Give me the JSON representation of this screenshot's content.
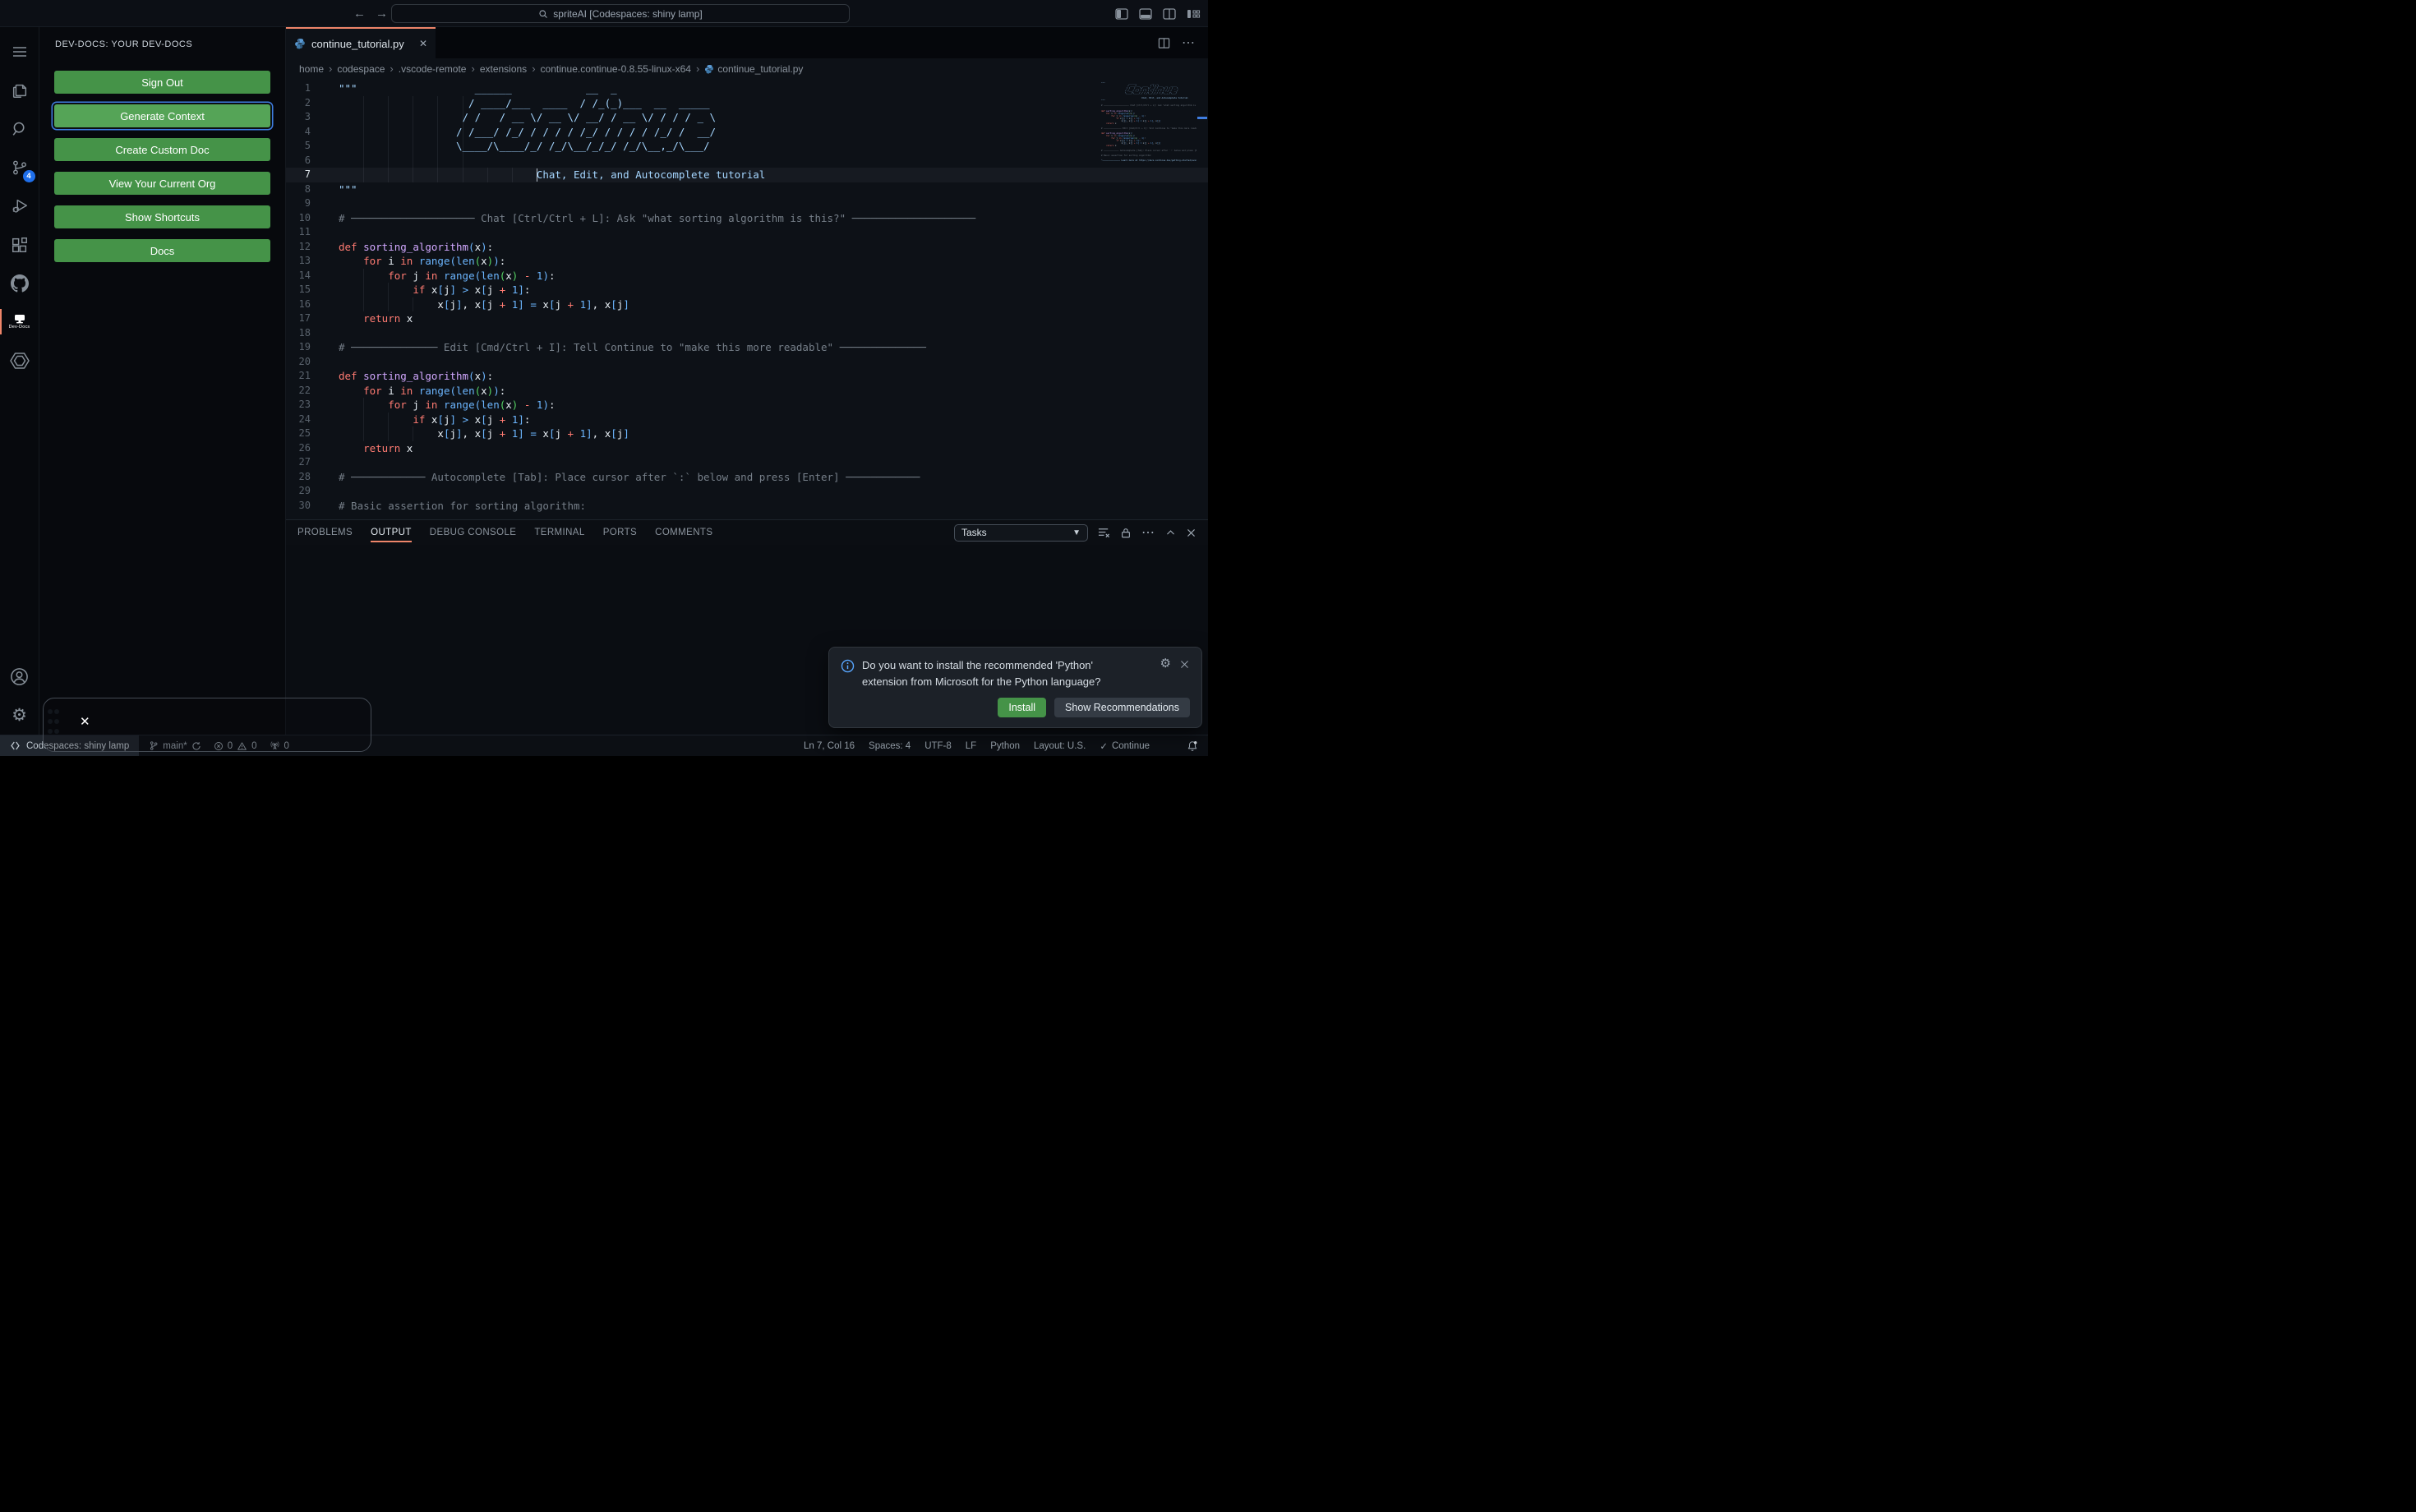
{
  "colors": {
    "accent_orange": "#ee8569",
    "button_green": "#459348",
    "focus_ring_blue": "#3f7de0",
    "badge_blue": "#1f6feb",
    "info_blue": "#58a6ff",
    "string_blue": "#a5d6ff",
    "keyword_red": "#ff7b72"
  },
  "titlebar": {
    "search": "spriteAI [Codespaces: shiny lamp]",
    "back": "←",
    "forward": "→"
  },
  "activity_bar": {
    "badge": "4",
    "devdocs": "Dev-Docs"
  },
  "sidebar": {
    "title": "DEV-DOCS: YOUR DEV-DOCS",
    "buttons": [
      {
        "label": "Sign Out"
      },
      {
        "label": "Generate Context",
        "focused": true
      },
      {
        "label": "Create Custom Doc"
      },
      {
        "label": "View Your Current Org"
      },
      {
        "label": "Show Shortcuts"
      },
      {
        "label": "Docs"
      }
    ]
  },
  "editor": {
    "tab": "continue_tutorial.py",
    "tab_close": "✕",
    "breadcrumbs": [
      "home",
      "codespace",
      ".vscode-remote",
      "extensions",
      "continue.continue-0.8.55-linux-x64",
      "continue_tutorial.py"
    ],
    "cursor": {
      "line": 7,
      "col": 16
    },
    "lines": [
      {
        "n": 1,
        "t": [
          [
            "s",
            "\"\"\"                   ______            __  _"
          ]
        ]
      },
      {
        "n": 2,
        "g": 5,
        "t": [
          [
            "s",
            "                     / ____/___  ____  / /_(_)___  __  _____"
          ]
        ]
      },
      {
        "n": 3,
        "g": 5,
        "t": [
          [
            "s",
            "                    / /   / __ \\/ __ \\/ __/ / __ \\/ / / / _ \\"
          ]
        ]
      },
      {
        "n": 4,
        "g": 5,
        "t": [
          [
            "s",
            "                   / /___/ /_/ / / / / /_/ / / / / /_/ /  __/"
          ]
        ]
      },
      {
        "n": 5,
        "g": 5,
        "t": [
          [
            "s",
            "                   \\____/\\____/_/ /_/\\__/_/_/ /_/\\__,_/\\___/"
          ]
        ]
      },
      {
        "n": 6,
        "g": 5,
        "t": []
      },
      {
        "n": 7,
        "g": 7,
        "t": [
          [
            "s",
            "                                Chat, Edit, and Autocomplete tutorial"
          ]
        ]
      },
      {
        "n": 8,
        "t": [
          [
            "s",
            "\"\"\""
          ]
        ]
      },
      {
        "n": 9,
        "t": []
      },
      {
        "n": 10,
        "t": [
          [
            "c",
            "# ──────────────────── Chat [Ctrl/Ctrl + L]: Ask \"what sorting algorithm is this?\" ────────────────────"
          ]
        ]
      },
      {
        "n": 11,
        "t": []
      },
      {
        "n": 12,
        "t": [
          [
            "k",
            "def"
          ],
          [
            "w",
            " "
          ],
          [
            "d",
            "sorting_algorithm"
          ],
          [
            "b",
            "("
          ],
          [
            "w",
            "x"
          ],
          [
            "b",
            ")"
          ],
          [
            "w",
            ":"
          ]
        ]
      },
      {
        "n": 13,
        "t": [
          [
            "w",
            "    "
          ],
          [
            "k",
            "for"
          ],
          [
            "w",
            " i "
          ],
          [
            "k",
            "in"
          ],
          [
            "w",
            " "
          ],
          [
            "b",
            "range"
          ],
          [
            "b",
            "("
          ],
          [
            "b",
            "len"
          ],
          [
            "e",
            "("
          ],
          [
            "w",
            "x"
          ],
          [
            "e",
            ")"
          ],
          [
            "b",
            ")"
          ],
          [
            "w",
            ":"
          ]
        ]
      },
      {
        "n": 14,
        "g": 1,
        "t": [
          [
            "w",
            "        "
          ],
          [
            "k",
            "for"
          ],
          [
            "w",
            " j "
          ],
          [
            "k",
            "in"
          ],
          [
            "w",
            " "
          ],
          [
            "b",
            "range"
          ],
          [
            "b",
            "("
          ],
          [
            "b",
            "len"
          ],
          [
            "e",
            "("
          ],
          [
            "w",
            "x"
          ],
          [
            "e",
            ")"
          ],
          [
            "w",
            " "
          ],
          [
            "k",
            "-"
          ],
          [
            "w",
            " "
          ],
          [
            "b",
            "1"
          ],
          [
            "b",
            ")"
          ],
          [
            "w",
            ":"
          ]
        ]
      },
      {
        "n": 15,
        "g": 2,
        "t": [
          [
            "w",
            "            "
          ],
          [
            "k",
            "if"
          ],
          [
            "w",
            " x"
          ],
          [
            "b",
            "["
          ],
          [
            "w",
            "j"
          ],
          [
            "b",
            "]"
          ],
          [
            "w",
            " "
          ],
          [
            "b",
            ">"
          ],
          [
            "w",
            " x"
          ],
          [
            "b",
            "["
          ],
          [
            "w",
            "j "
          ],
          [
            "k",
            "+"
          ],
          [
            "w",
            " "
          ],
          [
            "b",
            "1"
          ],
          [
            "b",
            "]"
          ],
          [
            "w",
            ":"
          ]
        ]
      },
      {
        "n": 16,
        "g": 3,
        "t": [
          [
            "w",
            "                x"
          ],
          [
            "b",
            "["
          ],
          [
            "w",
            "j"
          ],
          [
            "b",
            "]"
          ],
          [
            "w",
            ", x"
          ],
          [
            "b",
            "["
          ],
          [
            "w",
            "j "
          ],
          [
            "k",
            "+"
          ],
          [
            "w",
            " "
          ],
          [
            "b",
            "1"
          ],
          [
            "b",
            "]"
          ],
          [
            "w",
            " "
          ],
          [
            "b",
            "="
          ],
          [
            "w",
            " x"
          ],
          [
            "b",
            "["
          ],
          [
            "w",
            "j "
          ],
          [
            "k",
            "+"
          ],
          [
            "w",
            " "
          ],
          [
            "b",
            "1"
          ],
          [
            "b",
            "]"
          ],
          [
            "w",
            ", x"
          ],
          [
            "b",
            "["
          ],
          [
            "w",
            "j"
          ],
          [
            "b",
            "]"
          ]
        ]
      },
      {
        "n": 17,
        "t": [
          [
            "w",
            "    "
          ],
          [
            "k",
            "return"
          ],
          [
            "w",
            " x"
          ]
        ]
      },
      {
        "n": 18,
        "t": []
      },
      {
        "n": 19,
        "t": [
          [
            "c",
            "# ────────────── Edit [Cmd/Ctrl + I]: Tell Continue to \"make this more readable\" ──────────────"
          ]
        ]
      },
      {
        "n": 20,
        "t": []
      },
      {
        "n": 21,
        "t": [
          [
            "k",
            "def"
          ],
          [
            "w",
            " "
          ],
          [
            "d",
            "sorting_algorithm"
          ],
          [
            "b",
            "("
          ],
          [
            "w",
            "x"
          ],
          [
            "b",
            ")"
          ],
          [
            "w",
            ":"
          ]
        ]
      },
      {
        "n": 22,
        "t": [
          [
            "w",
            "    "
          ],
          [
            "k",
            "for"
          ],
          [
            "w",
            " i "
          ],
          [
            "k",
            "in"
          ],
          [
            "w",
            " "
          ],
          [
            "b",
            "range"
          ],
          [
            "b",
            "("
          ],
          [
            "b",
            "len"
          ],
          [
            "e",
            "("
          ],
          [
            "w",
            "x"
          ],
          [
            "e",
            ")"
          ],
          [
            "b",
            ")"
          ],
          [
            "w",
            ":"
          ]
        ]
      },
      {
        "n": 23,
        "g": 1,
        "t": [
          [
            "w",
            "        "
          ],
          [
            "k",
            "for"
          ],
          [
            "w",
            " j "
          ],
          [
            "k",
            "in"
          ],
          [
            "w",
            " "
          ],
          [
            "b",
            "range"
          ],
          [
            "b",
            "("
          ],
          [
            "b",
            "len"
          ],
          [
            "e",
            "("
          ],
          [
            "w",
            "x"
          ],
          [
            "e",
            ")"
          ],
          [
            "w",
            " "
          ],
          [
            "k",
            "-"
          ],
          [
            "w",
            " "
          ],
          [
            "b",
            "1"
          ],
          [
            "b",
            ")"
          ],
          [
            "w",
            ":"
          ]
        ]
      },
      {
        "n": 24,
        "g": 2,
        "t": [
          [
            "w",
            "            "
          ],
          [
            "k",
            "if"
          ],
          [
            "w",
            " x"
          ],
          [
            "b",
            "["
          ],
          [
            "w",
            "j"
          ],
          [
            "b",
            "]"
          ],
          [
            "w",
            " "
          ],
          [
            "b",
            ">"
          ],
          [
            "w",
            " x"
          ],
          [
            "b",
            "["
          ],
          [
            "w",
            "j "
          ],
          [
            "k",
            "+"
          ],
          [
            "w",
            " "
          ],
          [
            "b",
            "1"
          ],
          [
            "b",
            "]"
          ],
          [
            "w",
            ":"
          ]
        ]
      },
      {
        "n": 25,
        "g": 3,
        "t": [
          [
            "w",
            "                x"
          ],
          [
            "b",
            "["
          ],
          [
            "w",
            "j"
          ],
          [
            "b",
            "]"
          ],
          [
            "w",
            ", x"
          ],
          [
            "b",
            "["
          ],
          [
            "w",
            "j "
          ],
          [
            "k",
            "+"
          ],
          [
            "w",
            " "
          ],
          [
            "b",
            "1"
          ],
          [
            "b",
            "]"
          ],
          [
            "w",
            " "
          ],
          [
            "b",
            "="
          ],
          [
            "w",
            " x"
          ],
          [
            "b",
            "["
          ],
          [
            "w",
            "j "
          ],
          [
            "k",
            "+"
          ],
          [
            "w",
            " "
          ],
          [
            "b",
            "1"
          ],
          [
            "b",
            "]"
          ],
          [
            "w",
            ", x"
          ],
          [
            "b",
            "["
          ],
          [
            "w",
            "j"
          ],
          [
            "b",
            "]"
          ]
        ]
      },
      {
        "n": 26,
        "t": [
          [
            "w",
            "    "
          ],
          [
            "k",
            "return"
          ],
          [
            "w",
            " x"
          ]
        ]
      },
      {
        "n": 27,
        "t": []
      },
      {
        "n": 28,
        "t": [
          [
            "c",
            "# ──────────── Autocomplete [Tab]: Place cursor after `:` below and press [Enter] ────────────"
          ]
        ]
      },
      {
        "n": 29,
        "t": []
      },
      {
        "n": 30,
        "t": [
          [
            "c",
            "# Basic assertion for sorting algorithm:"
          ]
        ]
      }
    ],
    "minimap_tail": [
      {
        "t": []
      },
      {
        "t": [
          [
            "s",
            "\"────────────── Learn more at https://docs.continue.dev/getting-started/overview ──────────────\""
          ]
        ]
      }
    ]
  },
  "panel": {
    "tabs": [
      "PROBLEMS",
      "OUTPUT",
      "DEBUG CONSOLE",
      "TERMINAL",
      "PORTS",
      "COMMENTS"
    ],
    "active_index": 1,
    "tasks": "Tasks"
  },
  "notification": {
    "message": "Do you want to install the recommended 'Python' extension from Microsoft for the Python language?",
    "install": "Install",
    "show": "Show Recommendations"
  },
  "status_bar": {
    "remote": "Codespaces: shiny lamp",
    "branch": "main*",
    "errors": "0",
    "warnings": "0",
    "ports": "0",
    "line_col": "Ln 7, Col 16",
    "spaces": "Spaces: 4",
    "encoding": "UTF-8",
    "eol": "LF",
    "language": "Python",
    "layout": "Layout: U.S.",
    "continue_label": "Continue"
  },
  "float_widget": {
    "close": "✕"
  }
}
